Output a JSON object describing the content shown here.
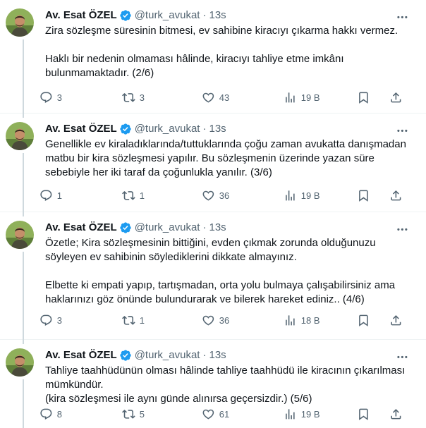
{
  "colors": {
    "text": "#0f1419",
    "muted": "#536471",
    "verified": "#1d9bf0",
    "divider": "#eff3f4",
    "thread_line": "#cfd9de"
  },
  "author": {
    "name": "Av. Esat ÖZEL",
    "handle": "@turk_avukat",
    "separator": "·",
    "verified_icon": "verified-badge-icon"
  },
  "tweets": [
    {
      "time": "13s",
      "text": "Zira sözleşme süresinin bitmesi, ev sahibine kiracıyı çıkarma hakkı vermez.\n\nHaklı bir nedenin olmaması hâlinde, kiracıyı tahliye etme imkânı bulunmamaktadır. (2/6)",
      "replies": "3",
      "retweets": "3",
      "likes": "43",
      "views": "19 B"
    },
    {
      "time": "13s",
      "text": "Genellikle ev kiraladıklarında/tuttuklarında çoğu zaman avukatta danışmadan matbu bir kira sözleşmesi yapılır. Bu sözleşmenin üzerinde yazan süre sebebiyle her iki taraf da çoğunlukla yanılır. (3/6)",
      "replies": "1",
      "retweets": "1",
      "likes": "36",
      "views": "19 B"
    },
    {
      "time": "13s",
      "text": "Özetle; Kira sözleşmesinin bittiğini, evden çıkmak zorunda olduğunuzu söyleyen ev sahibinin söylediklerini dikkate almayınız.\n\nElbette ki empati yapıp, tartışmadan, orta yolu bulmaya çalışabilirsiniz ama haklarınızı göz önünde bulundurarak ve bilerek hareket ediniz.. (4/6)",
      "replies": "3",
      "retweets": "1",
      "likes": "36",
      "views": "18 B"
    },
    {
      "time": "13s",
      "text": "Tahliye taahhüdünün olması hâlinde tahliye taahhüdü ile kiracının çıkarılması mümkündür.\n(kira sözleşmesi ile aynı günde alınırsa geçersizdir.) (5/6)",
      "replies": "8",
      "retweets": "5",
      "likes": "61",
      "views": "19 B"
    }
  ],
  "icons": {
    "reply": "reply-icon",
    "retweet": "retweet-icon",
    "like": "heart-icon",
    "views": "views-icon",
    "bookmark": "bookmark-icon",
    "share": "share-icon",
    "more": "more-icon"
  }
}
